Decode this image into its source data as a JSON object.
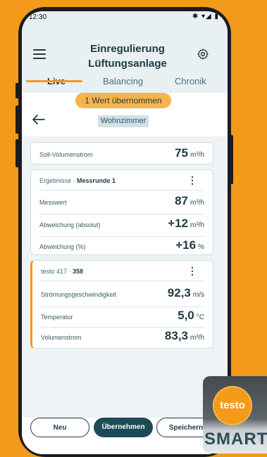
{
  "status": {
    "time": "12:30",
    "icons": "✱ ▾◢ ▮"
  },
  "header": {
    "title_line1": "Einregulierung",
    "title_line2": "Lüftungsanlage"
  },
  "tabs": [
    {
      "label": "Live"
    },
    {
      "label": "Balancing"
    },
    {
      "label": "Chronik"
    }
  ],
  "toast": {
    "text": "1 Wert übernommen"
  },
  "room": {
    "label": "Wohnzimmer"
  },
  "setpoint": {
    "label": "Soll-Volumenstrom",
    "value": "75",
    "unit": "m³/h"
  },
  "results": {
    "title_prefix": "Ergebnisse ·",
    "title_bold": "Messrunde 1",
    "rows": [
      {
        "label": "Messwert",
        "value": "87",
        "unit": "m³/h"
      },
      {
        "label": "Abweichung (absolut)",
        "value": "+12",
        "unit": "m³/h"
      },
      {
        "label": "Abweichung (%)",
        "value": "+16",
        "unit": "%"
      }
    ]
  },
  "probe": {
    "title_prefix": "testo 417 ·",
    "title_bold": "358",
    "accent": "#f39a1a",
    "rows": [
      {
        "label": "Strömungsgeschwindigkeit",
        "value": "92,3",
        "unit": "m/s"
      },
      {
        "label": "Temperatur",
        "value": "5,0",
        "unit": "°C"
      },
      {
        "label": "Volumenstrom",
        "value": "83,3",
        "unit": "m³/h"
      }
    ]
  },
  "buttons": {
    "new": "Neu",
    "apply": "Übernehmen",
    "save": "Speichern"
  },
  "logo": {
    "brand": "testo",
    "product": "SMART"
  },
  "colors": {
    "brand_orange": "#f39a1a",
    "primary_dark": "#1e4a55",
    "header_bg": "#e8f0f2"
  }
}
